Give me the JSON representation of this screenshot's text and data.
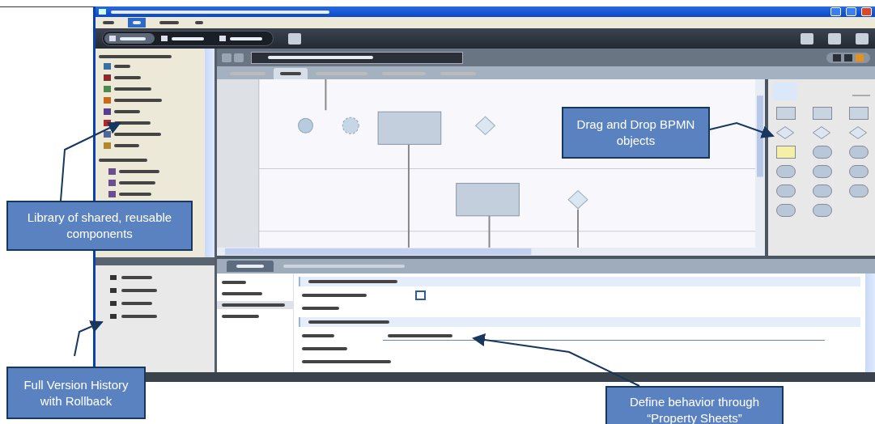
{
  "menu": [
    {
      "selected": false
    },
    {
      "selected": true
    },
    {
      "selected": false
    },
    {
      "selected": false
    }
  ],
  "checkbox": {
    "checked": false
  },
  "mode_tabs": [
    {
      "selected": true
    },
    {
      "selected": false
    },
    {
      "selected": false
    }
  ],
  "editor_tabs": [
    {
      "selected": false
    },
    {
      "selected": true
    },
    {
      "selected": false
    },
    {
      "selected": false
    },
    {
      "selected": false
    }
  ],
  "property_nav": [
    {
      "selected": false
    },
    {
      "selected": false
    },
    {
      "selected": true
    },
    {
      "selected": false
    }
  ],
  "callouts": [
    {
      "text": "Library of shared, reusable components"
    },
    {
      "text": "Drag and Drop BPMN objects"
    },
    {
      "text": "Full Version History with Rollback"
    },
    {
      "text": "Define behavior through “Property Sheets”"
    }
  ]
}
